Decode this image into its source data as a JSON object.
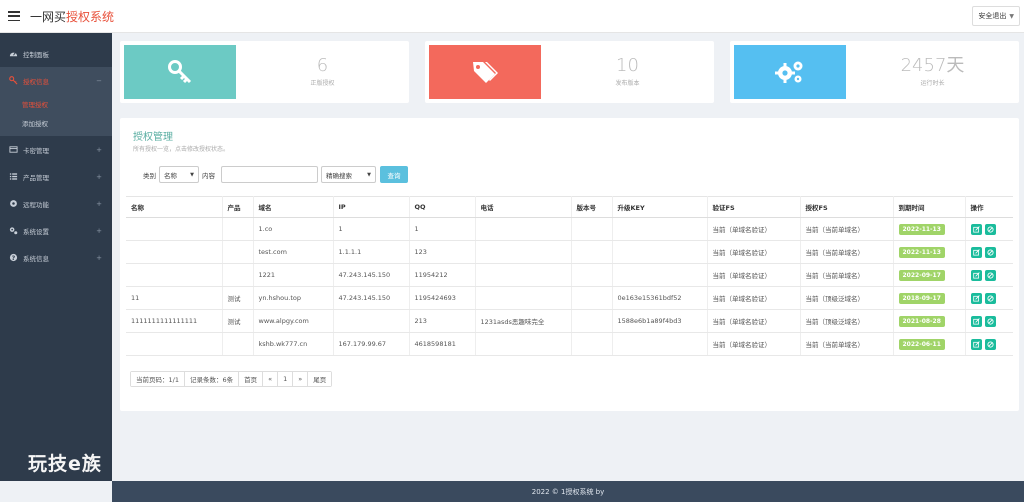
{
  "header": {
    "brand_main": "一网买",
    "brand_accent": "授权系统",
    "logout_label": "安全退出"
  },
  "sidebar": {
    "items": [
      {
        "label": "控制面板",
        "icon": "dashboard-icon"
      },
      {
        "label": "授权信息",
        "icon": "key-icon",
        "toggle": "−"
      },
      {
        "label": "卡密管理",
        "icon": "card-icon",
        "toggle": "+"
      },
      {
        "label": "产品管理",
        "icon": "list-icon",
        "toggle": "+"
      },
      {
        "label": "远程功能",
        "icon": "remote-icon",
        "toggle": "+"
      },
      {
        "label": "系统设置",
        "icon": "gears-icon",
        "toggle": "+"
      },
      {
        "label": "系统信息",
        "icon": "info-icon",
        "toggle": "+"
      }
    ],
    "sub_items": [
      {
        "label": "管理授权"
      },
      {
        "label": "添加授权"
      }
    ],
    "watermark": "玩技e族"
  },
  "stats": [
    {
      "value": "6",
      "label": "正版授权",
      "color": "#6ccac4",
      "icon": "key-icon"
    },
    {
      "value": "10",
      "label": "发布版本",
      "color": "#f3695c",
      "icon": "tags-icon"
    },
    {
      "value": "2457天",
      "label": "运行时长",
      "color": "#55bff1",
      "icon": "gears-icon"
    }
  ],
  "panel": {
    "title": "授权管理",
    "subtitle": "所有授权一览，点击修改授权状态。"
  },
  "search": {
    "category_label": "类别",
    "category_value": "名称",
    "content_label": "内容",
    "input_value": "",
    "mode_value": "精确搜索",
    "query_button": "查询"
  },
  "table": {
    "headers": [
      "名称",
      "产品",
      "域名",
      "IP",
      "QQ",
      "电话",
      "版本号",
      "升级KEY",
      "验证FS",
      "授权FS",
      "到期时间",
      "操作"
    ],
    "rows": [
      {
        "name": "",
        "product": "",
        "domain": "1.co",
        "ip": "1",
        "qq": "1",
        "phone": "",
        "version": "",
        "key": "",
        "verify": "当前（单域名验证）",
        "auth": "当前（当前单域名）",
        "expire": "2022-11-13"
      },
      {
        "name": "",
        "product": "",
        "domain": "test.com",
        "ip": "1.1.1.1",
        "qq": "123",
        "phone": "",
        "version": "",
        "key": "",
        "verify": "当前（单域名验证）",
        "auth": "当前（当前单域名）",
        "expire": "2022-11-13"
      },
      {
        "name": "",
        "product": "",
        "domain": "1221",
        "ip": "47.243.145.150",
        "qq": "11954212",
        "phone": "",
        "version": "",
        "key": "",
        "verify": "当前（单域名验证）",
        "auth": "当前（当前单域名）",
        "expire": "2022-09-17"
      },
      {
        "name": "11",
        "product": "测试",
        "domain": "yn.hshou.top",
        "ip": "47.243.145.150",
        "qq": "1195424693",
        "phone": "",
        "version": "",
        "key": "0e163e15361bdf52",
        "verify": "当前（单域名验证）",
        "auth": "当前（顶级泛域名）",
        "expire": "2018-09-17"
      },
      {
        "name": "1111111111111111",
        "product": "测试",
        "domain": "www.alpgy.com",
        "ip": "",
        "qq": "213",
        "phone": "1231asds恶趣味完全",
        "version": "",
        "key": "1588e6b1a89f4bd3",
        "verify": "当前（单域名验证）",
        "auth": "当前（顶级泛域名）",
        "expire": "2021-08-28"
      },
      {
        "name": "",
        "product": "",
        "domain": "kshb.wk777.cn",
        "ip": "167.179.99.67",
        "qq": "4618598181",
        "phone": "",
        "version": "",
        "key": "",
        "verify": "当前（单域名验证）",
        "auth": "当前（当前单域名）",
        "expire": "2022-06-11"
      }
    ]
  },
  "pagination": {
    "current": "当前页码：1/1",
    "count": "记录条数：6条",
    "first": "首页",
    "prev": "«",
    "page": "1",
    "next": "»",
    "last": "尾页"
  },
  "footer": {
    "text": "2022 © 1授权系统 by"
  },
  "colors": {
    "accent": "#e8503a",
    "sidebar_bg": "#2e3b4b",
    "badge": "#a0d468",
    "op_button": "#1abc9c"
  }
}
